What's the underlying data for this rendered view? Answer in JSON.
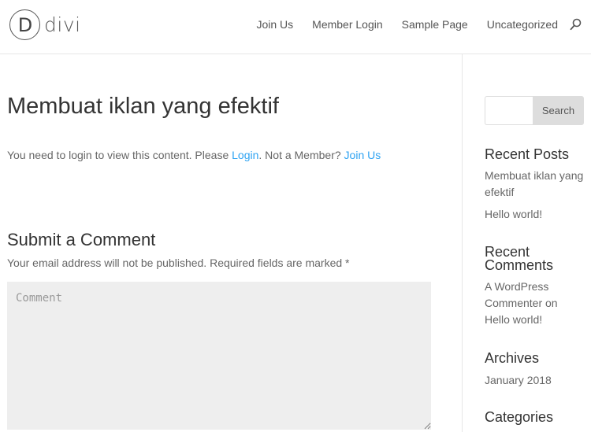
{
  "header": {
    "logo_letter": "D",
    "logo_text": "divi",
    "nav": [
      "Join Us",
      "Member Login",
      "Sample Page",
      "Uncategorized"
    ],
    "search_icon": "search-icon"
  },
  "main": {
    "title": "Membuat iklan yang efektif",
    "login_msg": {
      "prefix": "You need to login to view this content. Please ",
      "login_link": "Login",
      "middle": ". Not a Member? ",
      "join_link": "Join Us"
    },
    "comment_heading": "Submit a Comment",
    "comment_notes": "Your email address will not be published. Required fields are marked *",
    "comment_placeholder": "Comment"
  },
  "sidebar": {
    "search_button": "Search",
    "recent_posts_title": "Recent Posts",
    "recent_posts": [
      "Membuat iklan yang efektif",
      "Hello world!"
    ],
    "recent_comments_title": "Recent Comments",
    "recent_comment": "A WordPress Commenter on Hello world!",
    "archives_title": "Archives",
    "archives": [
      "January 2018"
    ],
    "categories_title": "Categories"
  },
  "colors": {
    "link": "#2ea3f2",
    "heading": "#333333",
    "body_text": "#666666",
    "border": "#e6e6e6",
    "comment_bg": "#eeeeee"
  }
}
